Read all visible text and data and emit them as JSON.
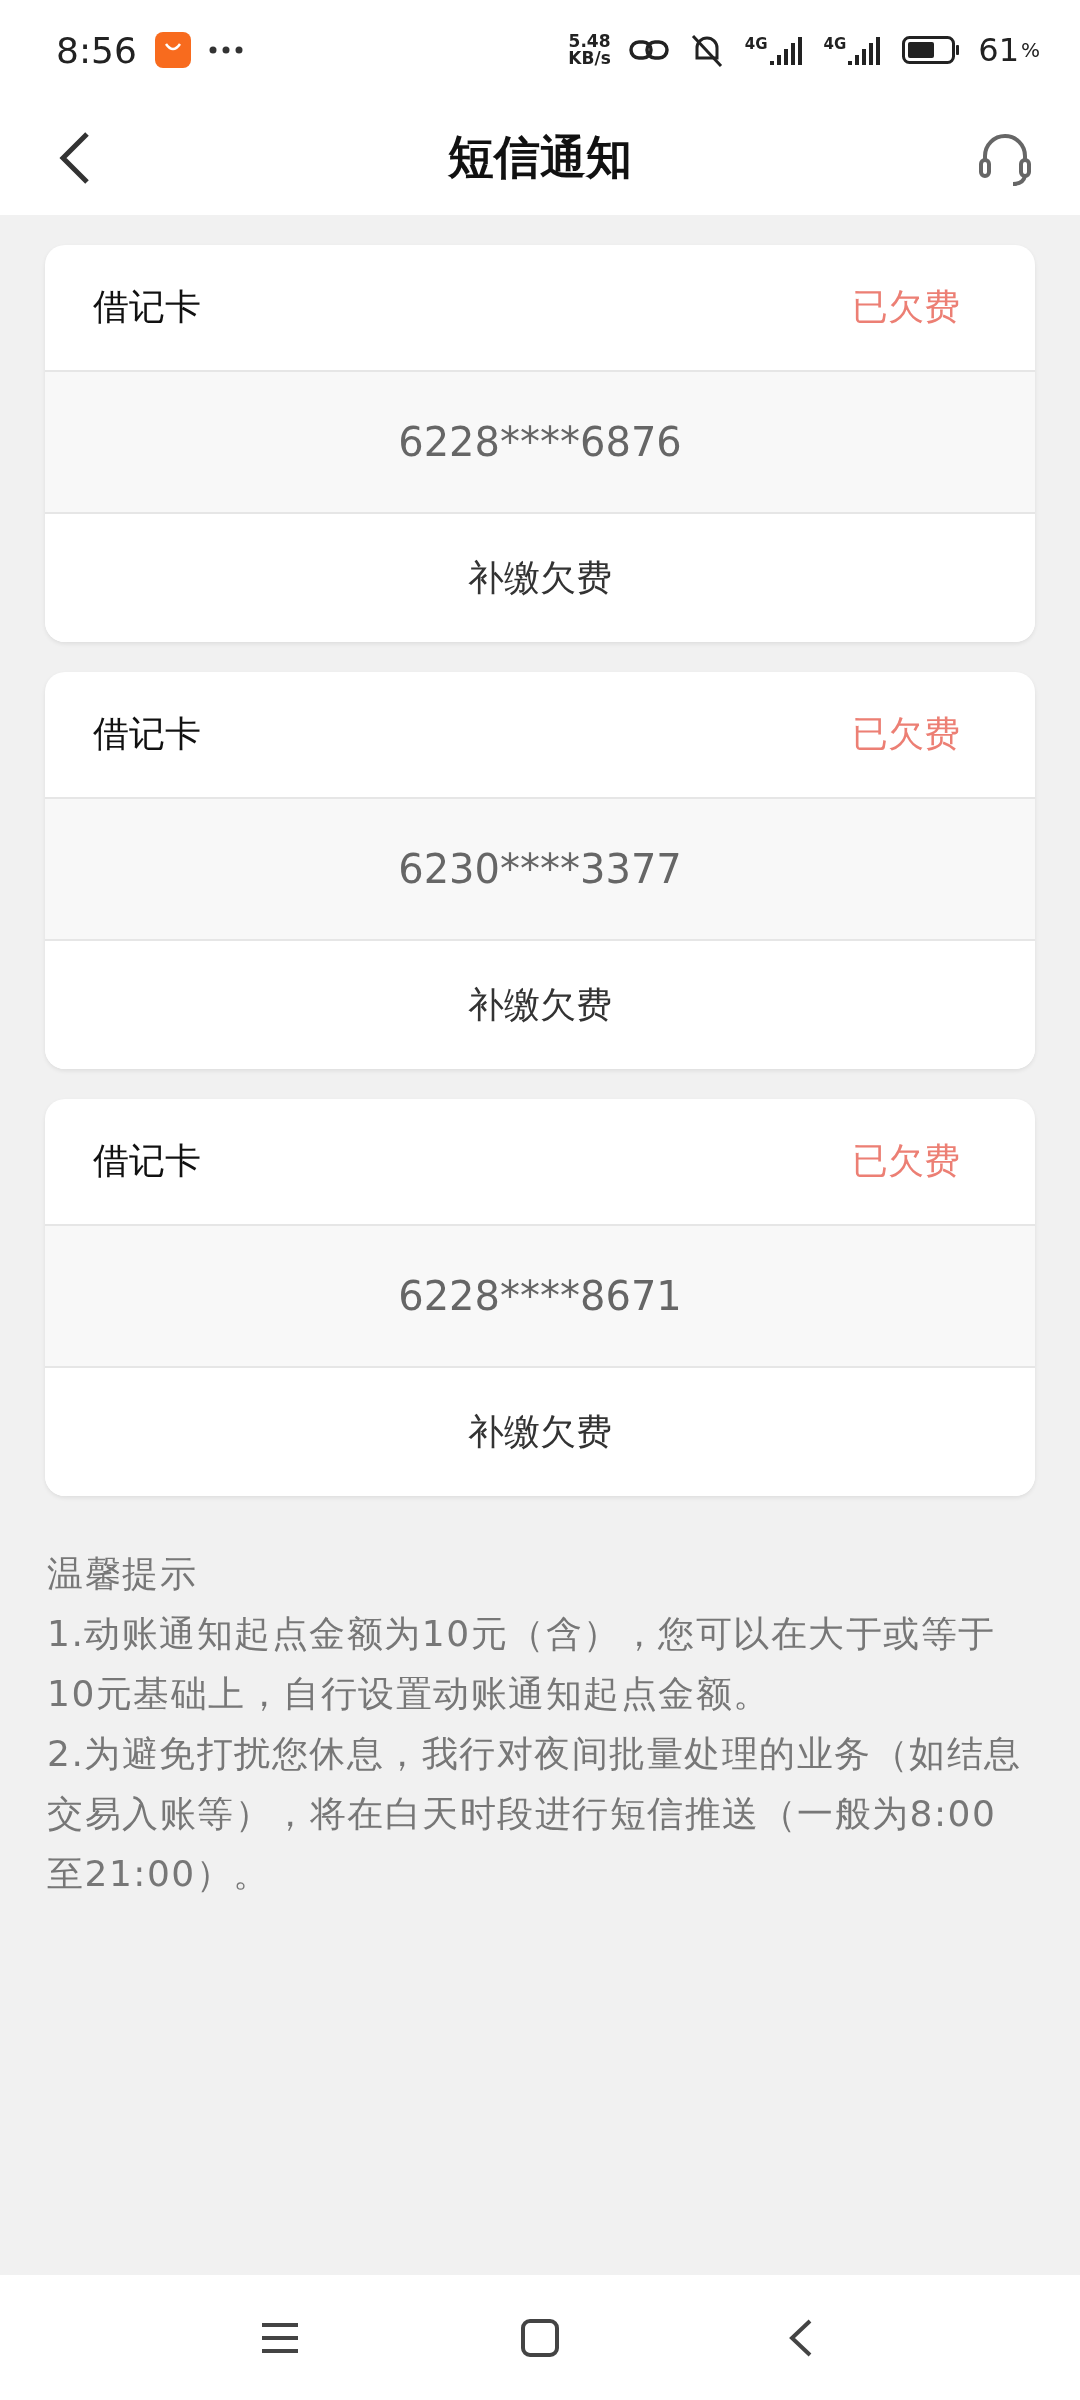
{
  "status_bar": {
    "time": "8:56",
    "speed_value": "5.48",
    "speed_unit": "KB/s",
    "network_1": "4G",
    "network_2": "4G",
    "battery": "61",
    "battery_unit": "%"
  },
  "header": {
    "title": "短信通知"
  },
  "cards": [
    {
      "type": "借记卡",
      "status": "已欠费",
      "number": "6228****6876",
      "action": "补缴欠费"
    },
    {
      "type": "借记卡",
      "status": "已欠费",
      "number": "6230****3377",
      "action": "补缴欠费"
    },
    {
      "type": "借记卡",
      "status": "已欠费",
      "number": "6228****8671",
      "action": "补缴欠费"
    }
  ],
  "tips": {
    "title": "温馨提示",
    "items": [
      "1.动账通知起点金额为10元（含），您可以在大于或等于10元基础上，自行设置动账通知起点金额。",
      "2.为避免打扰您休息，我行对夜间批量处理的业务（如结息交易入账等），将在白天时段进行短信推送（一般为8:00至21:00）。"
    ]
  }
}
